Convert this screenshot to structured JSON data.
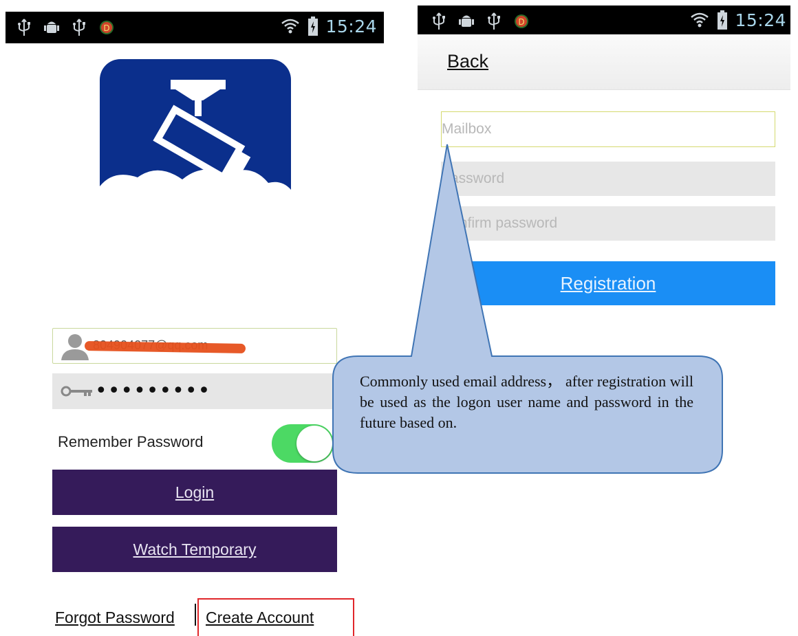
{
  "left_phone": {
    "statusbar": {
      "icons": [
        "usb-icon",
        "android-debug-icon",
        "usb-icon",
        "debug-d-icon"
      ],
      "time": "15:24"
    },
    "username_value": "804904077@qq.com",
    "password_masked": "•••••••••",
    "remember_label": "Remember Password",
    "remember_on": true,
    "login_label": "Login",
    "watch_label": "Watch Temporary",
    "forgot_label": "Forgot Password",
    "create_label": "Create Account"
  },
  "right_phone": {
    "statusbar": {
      "icons": [
        "usb-icon",
        "android-debug-icon",
        "usb-icon",
        "debug-d-icon"
      ],
      "time": "15:24"
    },
    "back_label": "Back",
    "mailbox_placeholder": "Mailbox",
    "password_placeholder": "Password",
    "confirm_placeholder": "Confirm password",
    "registration_label": "Registration"
  },
  "callout_text": "Commonly used email address，  after registration will be used as the logon user name and password in the future based on.",
  "colors": {
    "purple_button": "#351b5a",
    "registration_blue": "#1a8ef5",
    "toggle_green": "#4cd964",
    "highlight_red": "#e0262a",
    "callout_fill": "#b3c7e6",
    "callout_stroke": "#3f74b4",
    "logo_blue": "#0b2f8c"
  }
}
